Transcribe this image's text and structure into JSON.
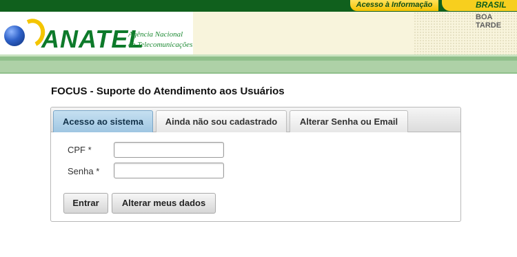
{
  "top_bar": {
    "acesso_label": "Acesso à Informação",
    "brasil_label": "BRASIL",
    "greeting": "BOA TARDE"
  },
  "logo": {
    "name": "ANATEL",
    "agency_line1": "Agência Nacional",
    "agency_line2": "de Telecomunicações"
  },
  "page": {
    "title": "FOCUS - Suporte do Atendimento aos Usuários"
  },
  "tabs": [
    {
      "label": "Acesso ao sistema",
      "active": true
    },
    {
      "label": "Ainda não sou cadastrado",
      "active": false
    },
    {
      "label": "Alterar Senha ou Email",
      "active": false
    }
  ],
  "form": {
    "cpf_label": "CPF *",
    "cpf_value": "",
    "senha_label": "Senha *",
    "senha_value": ""
  },
  "buttons": {
    "enter": "Entrar",
    "alter_data": "Alterar meus dados"
  },
  "colors": {
    "gov_green": "#10601d",
    "gov_yellow": "#f3c300",
    "brand_green": "#0d7a2a",
    "active_tab": "#9fc6e2"
  }
}
